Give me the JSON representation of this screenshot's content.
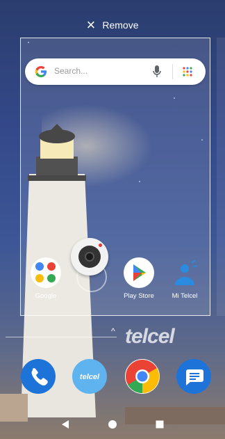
{
  "top_bar": {
    "remove_label": "Remove"
  },
  "search": {
    "placeholder": "Search..."
  },
  "apps": [
    {
      "label": "Google"
    },
    {
      "label": "Play Store"
    },
    {
      "label": "Mi Telcel"
    }
  ],
  "watermark": {
    "brand": "telcel"
  },
  "colors": {
    "telcel_blue": "#1e88e5",
    "phone_blue": "#1e73d8",
    "message_blue": "#1e73d8"
  }
}
